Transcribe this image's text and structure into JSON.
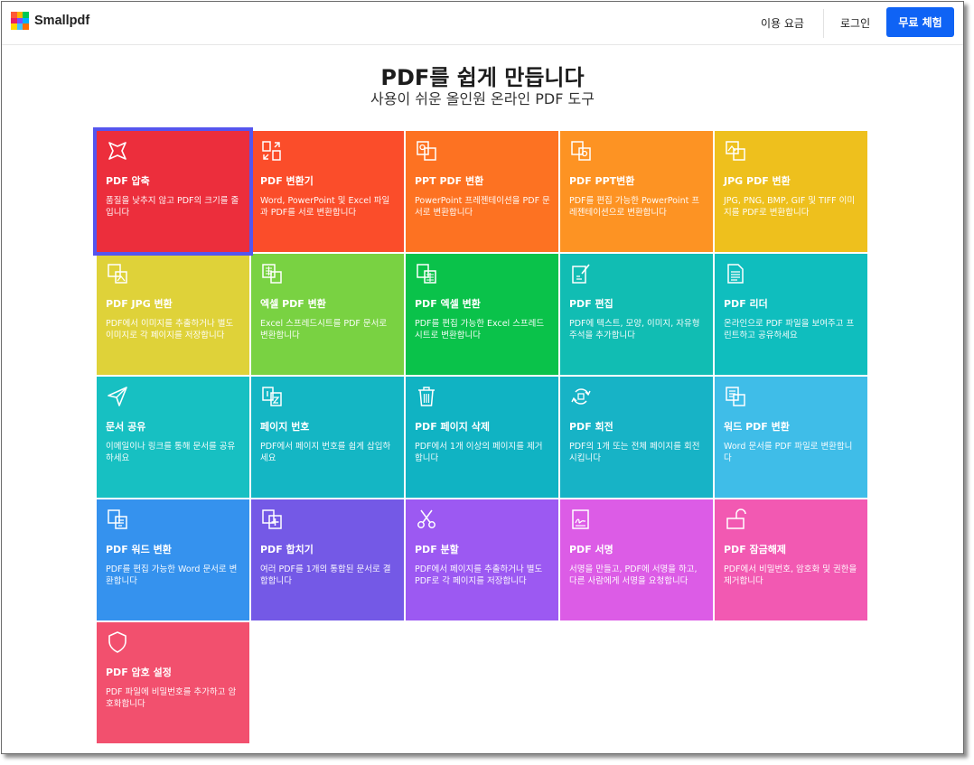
{
  "brand": {
    "name": "Smallpdf",
    "logo_colors": [
      "#ff5a36",
      "#ffb400",
      "#00c853",
      "#e91e63",
      "#7c4dff",
      "#00b0ff",
      "#ffd600",
      "#40c4ff",
      "#ff6d00"
    ]
  },
  "nav": {
    "pricing_label": "이용 요금",
    "login_label": "로그인",
    "trial_label": "무료 체험",
    "trial_color": "#0f63f5"
  },
  "hero": {
    "title": "PDF를 쉽게 만듭니다",
    "subtitle": "사용이 쉬운 올인원 온라인 PDF 도구"
  },
  "tools": [
    {
      "name": "PDF 압축",
      "desc": "품질을 낮추지 않고 PDF의 크기를 줄입니다",
      "color": "#ec2e3c",
      "icon": "compress-icon",
      "selected": true
    },
    {
      "name": "PDF 변환기",
      "desc": "Word, PowerPoint 및 Excel 파일과 PDF를 서로 변환합니다",
      "color": "#fb4d2a",
      "icon": "convert-icon"
    },
    {
      "name": "PPT PDF 변환",
      "desc": "PowerPoint 프레젠테이션을 PDF 문서로 변환합니다",
      "color": "#fd7222",
      "icon": "ppt-to-pdf-icon"
    },
    {
      "name": "PDF PPT변환",
      "desc": "PDF를 편집 가능한 PowerPoint 프레젠테이션으로 변환합니다",
      "color": "#fd9323",
      "icon": "pdf-to-ppt-icon"
    },
    {
      "name": "JPG PDF 변환",
      "desc": "JPG, PNG, BMP, GIF 및 TIFF 이미지를 PDF로 변환합니다",
      "color": "#eec01d",
      "icon": "jpg-to-pdf-icon"
    },
    {
      "name": "PDF JPG 변환",
      "desc": "PDF에서 이미지를 추출하거나 별도 이미지로 각 페이지를 저장합니다",
      "color": "#dfd239",
      "icon": "pdf-to-jpg-icon"
    },
    {
      "name": "엑셀 PDF 변환",
      "desc": "Excel 스프레드시트를 PDF 문서로 변환합니다",
      "color": "#79d242",
      "icon": "excel-to-pdf-icon"
    },
    {
      "name": "PDF 엑셀 변환",
      "desc": "PDF를 편집 가능한 Excel 스프레드시트로 변환합니다",
      "color": "#0ac24a",
      "icon": "pdf-to-excel-icon"
    },
    {
      "name": "PDF 편집",
      "desc": "PDF에 텍스트, 모양, 이미지, 자유형 주석을 추가합니다",
      "color": "#11bdb3",
      "icon": "edit-icon"
    },
    {
      "name": "PDF 리더",
      "desc": "온라인으로 PDF 파일을 보여주고 프린트하고 공유하세요",
      "color": "#0fbebe",
      "icon": "reader-icon"
    },
    {
      "name": "문서 공유",
      "desc": "이메일이나 링크를 통해 문서를 공유하세요",
      "color": "#17c0c2",
      "icon": "share-icon"
    },
    {
      "name": "페이지 번호",
      "desc": "PDF에서 페이지 번호를 쉽게 삽입하세요",
      "color": "#14b6c4",
      "icon": "page-number-icon"
    },
    {
      "name": "PDF 페이지 삭제",
      "desc": "PDF에서 1개 이상의 페이지를 제거합니다",
      "color": "#10b3c3",
      "icon": "trash-icon"
    },
    {
      "name": "PDF 회전",
      "desc": "PDF의 1개 또는 전체 페이지를 회전시킵니다",
      "color": "#17b3c6",
      "icon": "rotate-icon"
    },
    {
      "name": "워드 PDF 변환",
      "desc": "Word 문서를 PDF 파일로 변환합니다",
      "color": "#3fbde8",
      "icon": "word-to-pdf-icon"
    },
    {
      "name": "PDF 워드 변환",
      "desc": "PDF를 편집 가능한 Word 문서로 변환합니다",
      "color": "#3592ee",
      "icon": "pdf-to-word-icon"
    },
    {
      "name": "PDF 합치기",
      "desc": "여러 PDF를 1개의 통합된 문서로 결합합니다",
      "color": "#7459e6",
      "icon": "merge-icon"
    },
    {
      "name": "PDF 분할",
      "desc": "PDF에서 페이지를 추출하거나 별도 PDF로 각 페이지를 저장합니다",
      "color": "#9c59f2",
      "icon": "scissors-icon"
    },
    {
      "name": "PDF 서명",
      "desc": "서명을 만들고, PDF에 서명을 하고, 다른 사람에게 서명을 요청합니다",
      "color": "#dc5ce6",
      "icon": "sign-icon"
    },
    {
      "name": "PDF 잠금해제",
      "desc": "PDF에서 비밀번호, 암호화 및 권한을 제거합니다",
      "color": "#f259b2",
      "icon": "unlock-icon"
    },
    {
      "name": "PDF 암호 설정",
      "desc": "PDF 파일에 비밀번호를 추가하고 암호화합니다",
      "color": "#f2506e",
      "icon": "shield-icon"
    }
  ]
}
